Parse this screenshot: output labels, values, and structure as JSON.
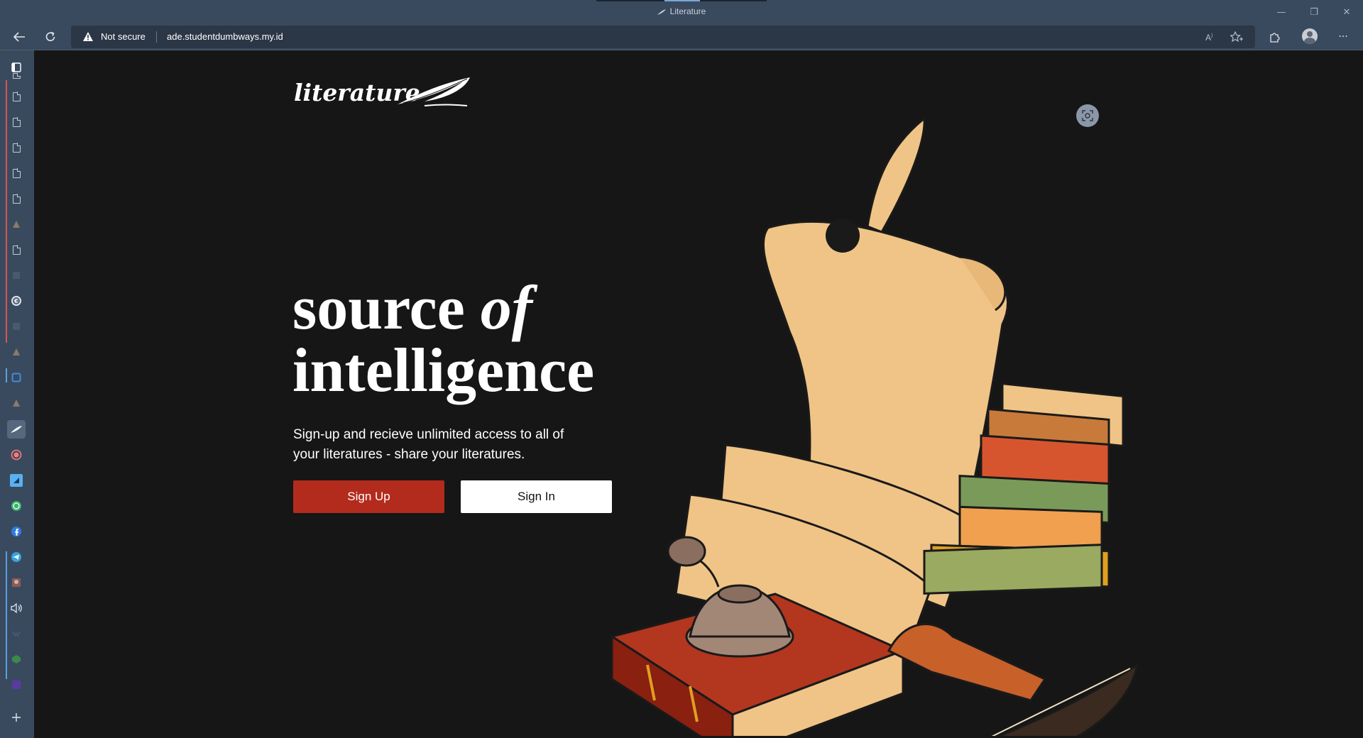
{
  "browser": {
    "tab_title": "Literature",
    "address": {
      "security_label": "Not secure",
      "url": "ade.studentdumbways.my.id"
    },
    "window_controls": {
      "minimize": "—",
      "restore": "❐",
      "close": "✕"
    },
    "toolbar_icons": [
      "read-aloud-icon",
      "favorites-icon",
      "extensions-icon",
      "profile-avatar",
      "more-menu-icon"
    ],
    "more_label": "···"
  },
  "sidebar": {
    "items": [
      "tab-actions-icon",
      "document-icon",
      "document-icon",
      "document-icon",
      "document-icon",
      "document-icon",
      "document-icon",
      "app-icon",
      "document-icon",
      "google-icon",
      "app-icon",
      "edit-icon",
      "app-icon",
      "literature-tab-icon",
      "record-icon",
      "app-icon",
      "whatsapp-icon",
      "facebook-icon",
      "telegram-icon",
      "app-icon",
      "speaker-icon",
      "app-icon",
      "app-icon",
      "app-icon",
      "add-icon"
    ]
  },
  "page": {
    "logo_text": "literature",
    "hero": {
      "title_line1": "source",
      "title_em": "of",
      "title_line2": "intelligence",
      "subtitle": "Sign-up and recieve unlimited access to all of your literatures - share your literatures."
    },
    "buttons": {
      "signup": "Sign Up",
      "signin": "Sign In"
    }
  },
  "colors": {
    "page_bg": "#161616",
    "chrome_bg": "#3a4a5e",
    "signup_bg": "#b32b1d",
    "signin_bg": "#ffffff",
    "scroll_paper": "#f0c486",
    "book_red": "#b3361f"
  }
}
